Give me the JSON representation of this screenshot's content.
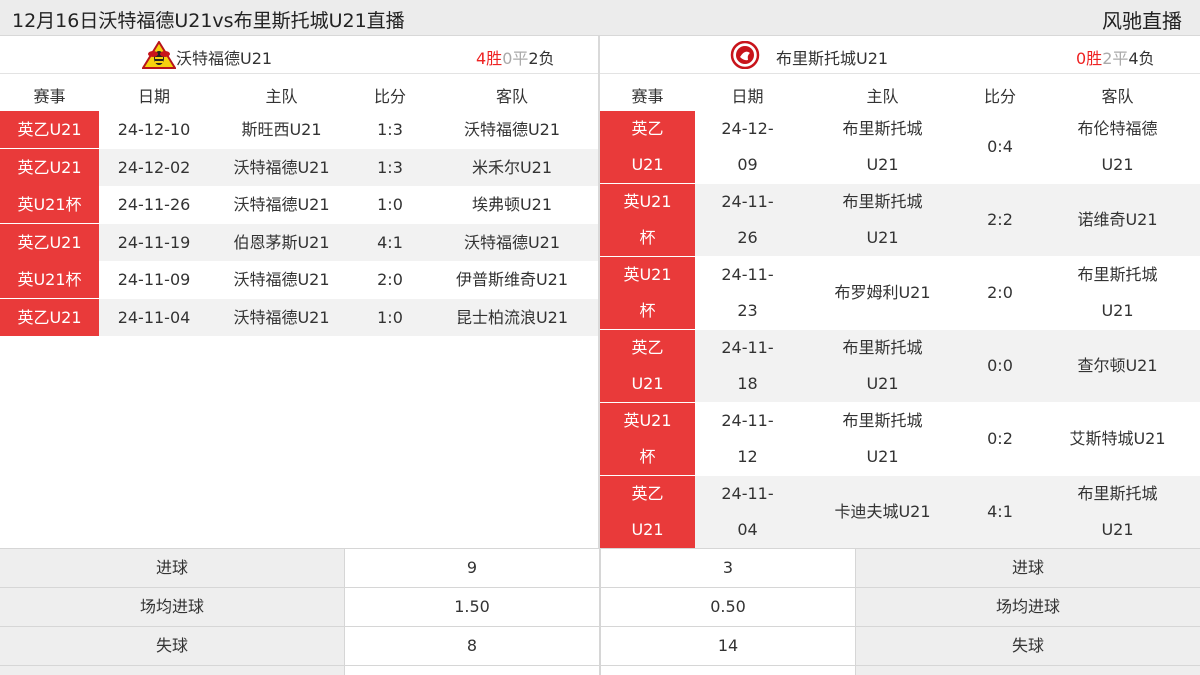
{
  "header": {
    "title": "12月16日沃特福德U21vs布里斯托城U21直播",
    "brand": "风驰直播"
  },
  "left_team": {
    "name": "沃特福德U21",
    "record": {
      "wins": "4胜",
      "draws": "0平",
      "losses": "2负"
    },
    "logo_icon": "watford-hornet-icon",
    "columns": [
      "赛事",
      "日期",
      "主队",
      "比分",
      "客队"
    ],
    "matches": [
      {
        "comp": "英乙U21",
        "date": "24-12-10",
        "home": "斯旺西U21",
        "score": "1:3",
        "away": "沃特福德U21"
      },
      {
        "comp": "英乙U21",
        "date": "24-12-02",
        "home": "沃特福德U21",
        "score": "1:3",
        "away": "米禾尔U21"
      },
      {
        "comp": "英U21杯",
        "date": "24-11-26",
        "home": "沃特福德U21",
        "score": "1:0",
        "away": "埃弗顿U21"
      },
      {
        "comp": "英乙U21",
        "date": "24-11-19",
        "home": "伯恩茅斯U21",
        "score": "4:1",
        "away": "沃特福德U21"
      },
      {
        "comp": "英U21杯",
        "date": "24-11-09",
        "home": "沃特福德U21",
        "score": "2:0",
        "away": "伊普斯维奇U21"
      },
      {
        "comp": "英乙U21",
        "date": "24-11-04",
        "home": "沃特福德U21",
        "score": "1:0",
        "away": "昆士柏流浪U21"
      }
    ]
  },
  "right_team": {
    "name": "布里斯托城U21",
    "record": {
      "wins": "0胜",
      "draws": "2平",
      "losses": "4负"
    },
    "logo_icon": "bristol-city-robin-icon",
    "columns": [
      "赛事",
      "日期",
      "主队",
      "比分",
      "客队"
    ],
    "matches": [
      {
        "comp1": "英乙",
        "comp2": "U21",
        "date1": "24-12-",
        "date2": "09",
        "home1": "布里斯托城",
        "home2": "U21",
        "score": "0:4",
        "away1": "布伦特福德",
        "away2": "U21"
      },
      {
        "comp1": "英U21",
        "comp2": "杯",
        "date1": "24-11-",
        "date2": "26",
        "home1": "布里斯托城",
        "home2": "U21",
        "score": "2:2",
        "away1": "诺维奇U21",
        "away2": ""
      },
      {
        "comp1": "英U21",
        "comp2": "杯",
        "date1": "24-11-",
        "date2": "23",
        "home1": "布罗姆利U21",
        "home2": "",
        "score": "2:0",
        "away1": "布里斯托城",
        "away2": "U21"
      },
      {
        "comp1": "英乙",
        "comp2": "U21",
        "date1": "24-11-",
        "date2": "18",
        "home1": "布里斯托城",
        "home2": "U21",
        "score": "0:0",
        "away1": "查尔顿U21",
        "away2": ""
      },
      {
        "comp1": "英U21",
        "comp2": "杯",
        "date1": "24-11-",
        "date2": "12",
        "home1": "布里斯托城",
        "home2": "U21",
        "score": "0:2",
        "away1": "艾斯特城U21",
        "away2": ""
      },
      {
        "comp1": "英乙",
        "comp2": "U21",
        "date1": "24-11-",
        "date2": "04",
        "home1": "卡迪夫城U21",
        "home2": "",
        "score": "4:1",
        "away1": "布里斯托城",
        "away2": "U21"
      }
    ]
  },
  "stats": [
    {
      "label": "进球",
      "left": "9",
      "right": "3"
    },
    {
      "label": "场均进球",
      "left": "1.50",
      "right": "0.50"
    },
    {
      "label": "失球",
      "left": "8",
      "right": "14"
    }
  ],
  "colors": {
    "accent_red": "#e93a3a",
    "win_red": "#ee2222",
    "draw_gray": "#aaaaaa"
  }
}
